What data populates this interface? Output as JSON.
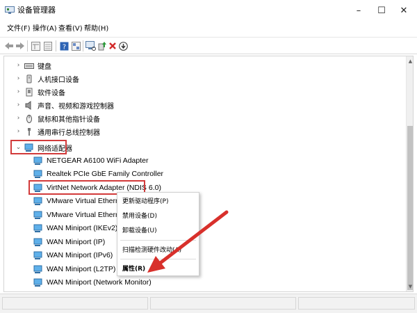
{
  "window": {
    "title": "设备管理器",
    "minimize": "–",
    "maximize": "☐",
    "close": "✕"
  },
  "menu": [
    {
      "label": "文件(F)"
    },
    {
      "label": "操作(A)"
    },
    {
      "label": "查看(V)"
    },
    {
      "label": "帮助(H)"
    }
  ],
  "tree": {
    "categories": [
      {
        "label": "键盘",
        "expander": "›",
        "icon": "keyboard-icon"
      },
      {
        "label": "人机接口设备",
        "expander": "›",
        "icon": "hid-icon"
      },
      {
        "label": "软件设备",
        "expander": "›",
        "icon": "software-device-icon"
      },
      {
        "label": "声音、视频和游戏控制器",
        "expander": "›",
        "icon": "speaker-icon"
      },
      {
        "label": "鼠标和其他指针设备",
        "expander": "›",
        "icon": "mouse-icon"
      },
      {
        "label": "通用串行总线控制器",
        "expander": "›",
        "icon": "usb-icon"
      },
      {
        "label": "网络适配器",
        "expander": "⌄",
        "icon": "network-adapter-icon"
      }
    ],
    "adapters": [
      {
        "label": "NETGEAR A6100 WiFi Adapter"
      },
      {
        "label": "Realtek PCIe GbE Family Controller"
      },
      {
        "label": "VirtNet Network Adapter (NDIS 6.0)"
      },
      {
        "label": "VMware Virtual Ethernet"
      },
      {
        "label": "VMware Virtual Ethernet"
      },
      {
        "label": "WAN Miniport (IKEv2)"
      },
      {
        "label": "WAN Miniport (IP)"
      },
      {
        "label": "WAN Miniport (IPv6)"
      },
      {
        "label": "WAN Miniport (L2TP)"
      },
      {
        "label": "WAN Miniport (Network Monitor)"
      }
    ]
  },
  "context_menu": {
    "update_driver": "更新驱动程序(P)",
    "disable_device": "禁用设备(D)",
    "uninstall_device": "卸载设备(U)",
    "scan_hardware": "扫描检测硬件改动(A)",
    "properties": "属性(R)"
  },
  "colors": {
    "highlight_box": "#d23a3a",
    "annotation_arrow": "#d8302b",
    "monitor_icon": "#2f8fd8"
  }
}
